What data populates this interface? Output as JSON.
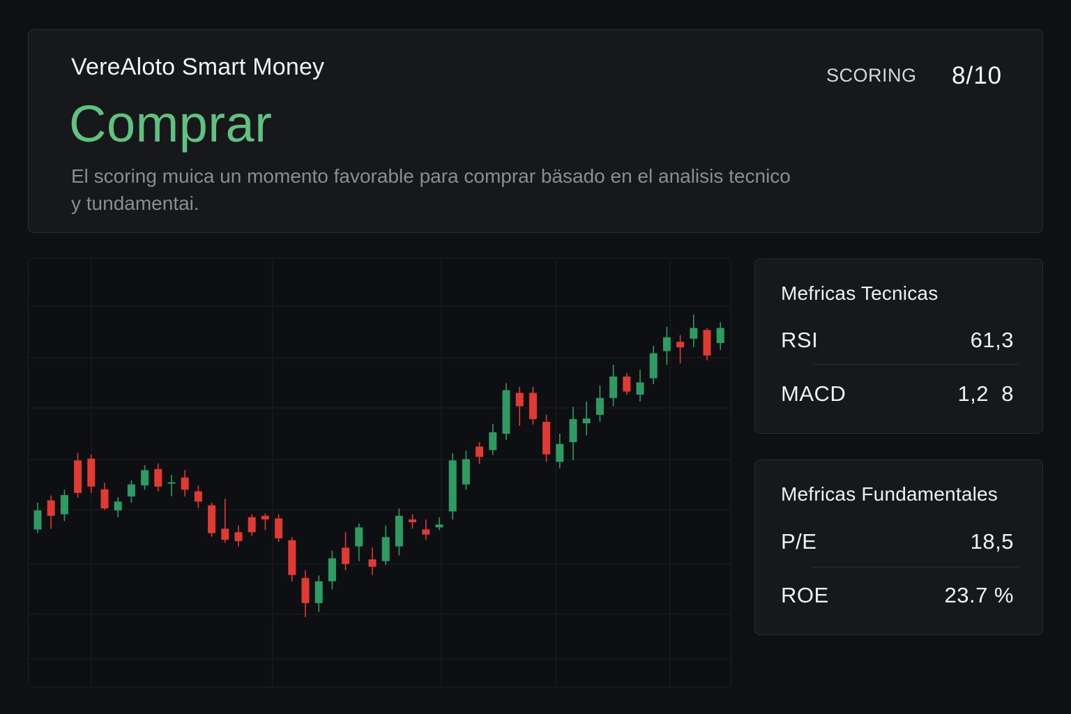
{
  "header": {
    "brand": "VereAloto Smart Money",
    "verdict": "Comprar",
    "description": "El scoring muica un momento favorable para comprar bäsado en el analisis tecnico y tundamentai.",
    "scoring_label": "SCORING",
    "scoring_value": "8/10"
  },
  "technical_metrics": {
    "title": "Mefricas Tecnicas",
    "rows": [
      {
        "name": "RSI",
        "value": "61,3"
      },
      {
        "name": "MACD",
        "value": "1,2  8"
      }
    ]
  },
  "fundamental_metrics": {
    "title": "Mefricas Fundamentales",
    "rows": [
      {
        "name": "P/E",
        "value": "18,5"
      },
      {
        "name": "ROE",
        "value": "23.7 %"
      }
    ]
  },
  "colors": {
    "accent_green": "#5fc27f",
    "candle_up": "#2e9b62",
    "candle_down": "#e03a32",
    "panel_background": "#17181b",
    "page_background": "#0f1012"
  },
  "chart_data": {
    "type": "candlestick",
    "title": "",
    "xlabel": "",
    "ylabel": "",
    "grid": true,
    "ylim": [
      0,
      100
    ],
    "candles": [
      {
        "open": 21.4,
        "close": 36.9,
        "high": 43.2,
        "low": 18.4
      },
      {
        "open": 45.1,
        "close": 32.5,
        "high": 49.1,
        "low": 22.0
      },
      {
        "open": 33.8,
        "close": 49.4,
        "high": 53.8,
        "low": 28.3
      },
      {
        "open": 77.7,
        "close": 51.2,
        "high": 83.8,
        "low": 47.3
      },
      {
        "open": 79.1,
        "close": 56.3,
        "high": 82.6,
        "low": 51.2
      },
      {
        "open": 54.1,
        "close": 38.6,
        "high": 59.4,
        "low": 37.1
      },
      {
        "open": 36.9,
        "close": 44.1,
        "high": 47.8,
        "low": 31.4
      },
      {
        "open": 48.3,
        "close": 58.1,
        "high": 61.4,
        "low": 43.2
      },
      {
        "open": 57.3,
        "close": 69.7,
        "high": 73.8,
        "low": 53.8
      },
      {
        "open": 70.6,
        "close": 56.3,
        "high": 75.2,
        "low": 52.6
      },
      {
        "open": 59.8,
        "close": 59.8,
        "high": 65.8,
        "low": 48.5
      },
      {
        "open": 63.7,
        "close": 53.8,
        "high": 69.9,
        "low": 48.3
      },
      {
        "open": 52.5,
        "close": 44.1,
        "high": 57.1,
        "low": 38.8
      },
      {
        "open": 41.1,
        "close": 18.4,
        "high": 43.2,
        "low": 15.4
      },
      {
        "open": 22.0,
        "close": 13.0,
        "high": 46.4,
        "low": 10.7
      },
      {
        "open": 19.2,
        "close": 11.9,
        "high": 24.6,
        "low": 7.6
      },
      {
        "open": 31.4,
        "close": 19.2,
        "high": 33.8,
        "low": 16.1
      },
      {
        "open": 32.5,
        "close": 29.6,
        "high": 34.4,
        "low": 20.8
      },
      {
        "open": 30.4,
        "close": 14.2,
        "high": 33.8,
        "low": 11.3
      },
      {
        "open": 12.6,
        "close": -15.7,
        "high": 15.2,
        "low": -21.0
      },
      {
        "open": -18.1,
        "close": -38.6,
        "high": -11.9,
        "low": -50.0
      },
      {
        "open": -38.6,
        "close": -20.8,
        "high": -16.1,
        "low": -45.7
      },
      {
        "open": -20.8,
        "close": -2.1,
        "high": 4.1,
        "low": -27.3
      },
      {
        "open": 6.5,
        "close": -6.7,
        "high": 19.2,
        "low": -11.9
      },
      {
        "open": 7.6,
        "close": 23.1,
        "high": 26.3,
        "low": -4.4
      },
      {
        "open": -3.0,
        "close": -9.0,
        "high": 6.5,
        "low": -15.7
      },
      {
        "open": -4.4,
        "close": 15.2,
        "high": 24.6,
        "low": -7.6
      },
      {
        "open": 7.6,
        "close": 32.5,
        "high": 38.6,
        "low": 0.2
      },
      {
        "open": 29.6,
        "close": 27.3,
        "high": 33.8,
        "low": 22.0
      },
      {
        "open": 21.4,
        "close": 17.3,
        "high": 29.6,
        "low": 13.0
      },
      {
        "open": 23.1,
        "close": 25.4,
        "high": 31.4,
        "low": 20.8
      },
      {
        "open": 36.1,
        "close": 77.7,
        "high": 83.4,
        "low": 29.6
      },
      {
        "open": 58.1,
        "close": 78.7,
        "high": 85.6,
        "low": 53.8
      },
      {
        "open": 88.9,
        "close": 80.5,
        "high": 92.6,
        "low": 74.8
      },
      {
        "open": 86.1,
        "close": 100.6,
        "high": 107.3,
        "low": 82.1
      },
      {
        "open": 99.4,
        "close": 134.9,
        "high": 140.6,
        "low": 94.4
      },
      {
        "open": 132.7,
        "close": 121.8,
        "high": 137.5,
        "low": 105.9
      },
      {
        "open": 132.7,
        "close": 111.3,
        "high": 137.5,
        "low": 106.9
      },
      {
        "open": 109.1,
        "close": 82.6,
        "high": 114.8,
        "low": 76.5
      },
      {
        "open": 76.5,
        "close": 91.1,
        "high": 99.4,
        "low": 71.1
      },
      {
        "open": 92.6,
        "close": 111.3,
        "high": 121.4,
        "low": 77.7
      },
      {
        "open": 107.9,
        "close": 111.8,
        "high": 125.6,
        "low": 98.1
      },
      {
        "open": 114.8,
        "close": 128.5,
        "high": 138.9,
        "low": 109.1
      },
      {
        "open": 128.5,
        "close": 146.0,
        "high": 155.6,
        "low": 121.8
      },
      {
        "open": 146.0,
        "close": 133.8,
        "high": 148.7,
        "low": 131.3
      },
      {
        "open": 131.3,
        "close": 141.2,
        "high": 151.5,
        "low": 125.6
      },
      {
        "open": 144.6,
        "close": 165.0,
        "high": 171.0,
        "low": 139.8
      },
      {
        "open": 166.7,
        "close": 178.0,
        "high": 186.4,
        "low": 155.6
      },
      {
        "open": 174.3,
        "close": 169.8,
        "high": 179.8,
        "low": 156.7
      },
      {
        "open": 176.9,
        "close": 185.6,
        "high": 196.6,
        "low": 170.0
      },
      {
        "open": 183.9,
        "close": 163.2,
        "high": 185.6,
        "low": 159.2
      },
      {
        "open": 173.3,
        "close": 185.6,
        "high": 190.4,
        "low": 167.8
      }
    ]
  }
}
